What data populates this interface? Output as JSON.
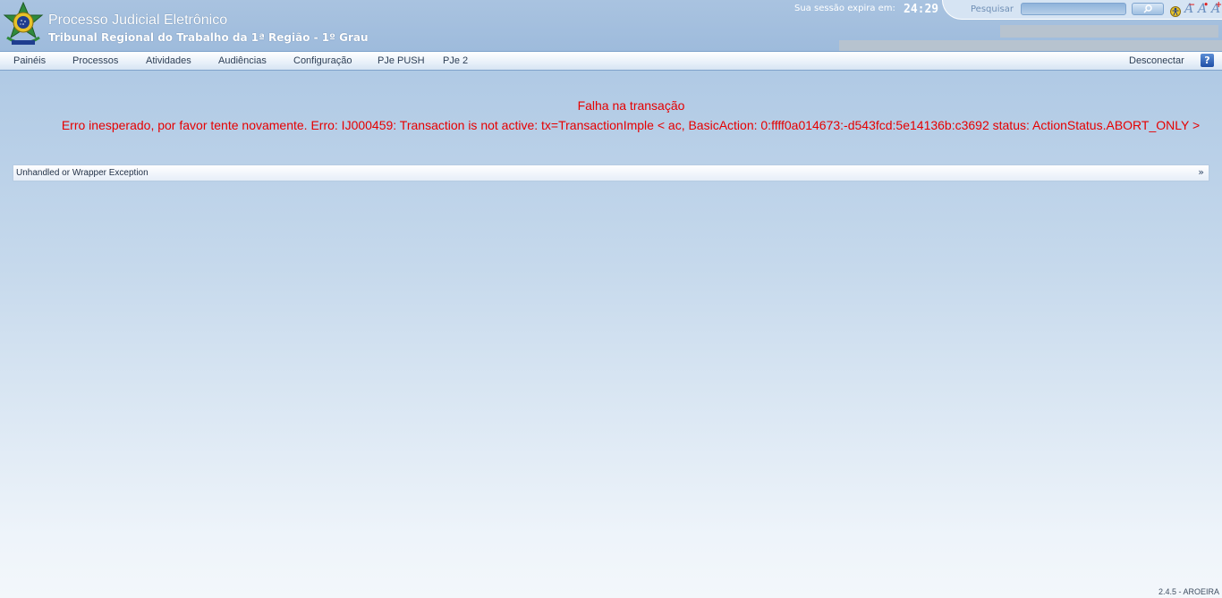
{
  "header": {
    "system_title": "Processo Judicial Eletrônico",
    "tribunal": "Tribunal Regional do Trabalho da 1ª Região - 1º Grau",
    "session_label": "Sua sessão expira em:",
    "session_time": "24:29",
    "search_label": "Pesquisar",
    "search_value": ""
  },
  "menu": {
    "items": [
      "Painéis",
      "Processos",
      "Atividades",
      "Audiências",
      "Configuração",
      "PJe PUSH",
      "PJe 2"
    ],
    "logout": "Desconectar",
    "help": "?"
  },
  "error": {
    "title": "Falha na transação",
    "message": "Erro inesperado, por favor tente novamente. Erro: IJ000459: Transaction is not active: tx=TransactionImple < ac, BasicAction: 0:ffff0a014673:-d543fcd:5e14136b:c3692 status: ActionStatus.ABORT_ONLY >"
  },
  "exception_panel": {
    "label": "Unhandled or Wrapper Exception",
    "toggle": "»"
  },
  "footer": {
    "version": "2.4.5 - AROEIRA"
  },
  "colors": {
    "error_text": "#e60000",
    "header_bg": "#a9c3e0",
    "menu_border": "#7fa3cb"
  },
  "icons": [
    "brasao-logo",
    "search-icon",
    "accessibility-icon",
    "font-decrease-icon",
    "font-normal-icon",
    "font-increase-icon",
    "help-icon"
  ]
}
